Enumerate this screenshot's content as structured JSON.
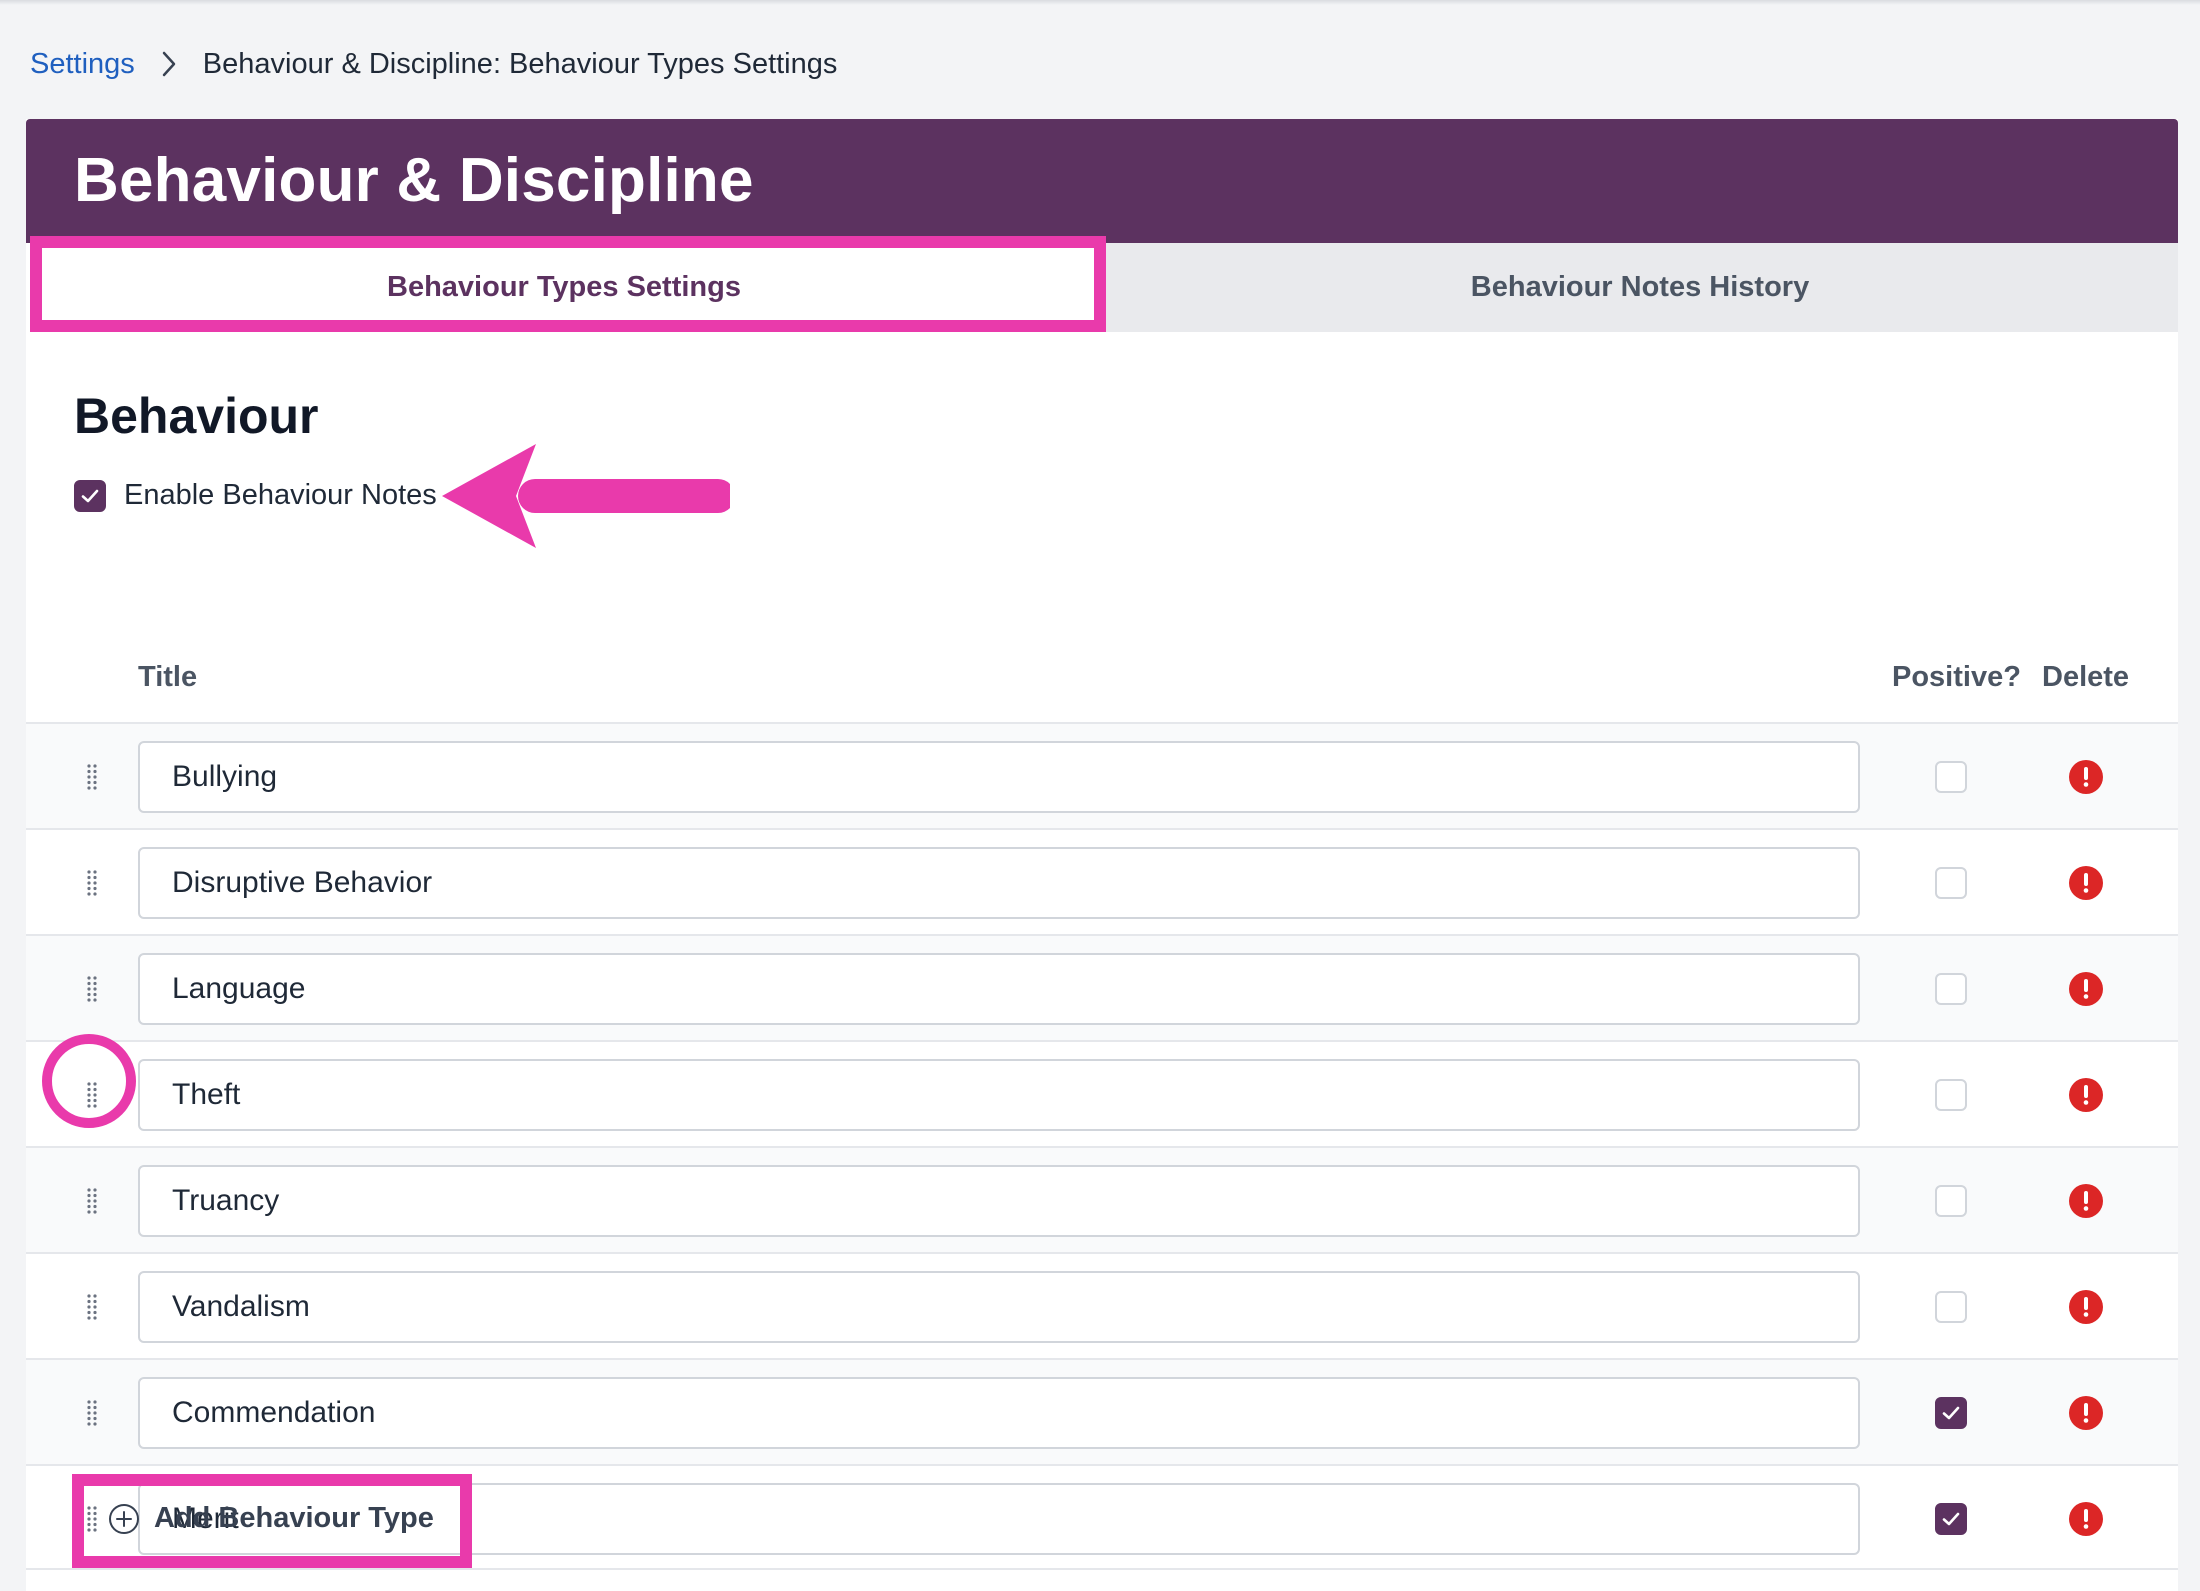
{
  "breadcrumb": {
    "root": "Settings",
    "current": "Behaviour & Discipline: Behaviour Types Settings"
  },
  "header": {
    "title": "Behaviour & Discipline"
  },
  "tabs": [
    {
      "label": "Behaviour Types Settings",
      "active": true
    },
    {
      "label": "Behaviour Notes History",
      "active": false
    }
  ],
  "section": {
    "title": "Behaviour",
    "enable_label": "Enable Behaviour Notes",
    "enable_checked": true
  },
  "columns": {
    "title": "Title",
    "positive": "Positive?",
    "delete": "Delete"
  },
  "behaviour_types": [
    {
      "title": "Bullying",
      "positive": false
    },
    {
      "title": "Disruptive Behavior",
      "positive": false
    },
    {
      "title": "Language",
      "positive": false
    },
    {
      "title": "Theft",
      "positive": false
    },
    {
      "title": "Truancy",
      "positive": false
    },
    {
      "title": "Vandalism",
      "positive": false
    },
    {
      "title": "Commendation",
      "positive": true
    },
    {
      "title": "Merit",
      "positive": true
    }
  ],
  "add_button": {
    "label": "Add Behaviour Type"
  },
  "colors": {
    "brand_purple": "#5c3260",
    "link_blue": "#1f5fbf",
    "delete_red": "#dc2626",
    "annotation_pink": "#e93aab"
  },
  "icons": {
    "breadcrumb_separator": "chevron-right-icon",
    "row_handle": "drag-handle-icon",
    "delete": "alert-circle-icon",
    "add": "plus-circle-icon",
    "check": "checkmark-icon"
  }
}
